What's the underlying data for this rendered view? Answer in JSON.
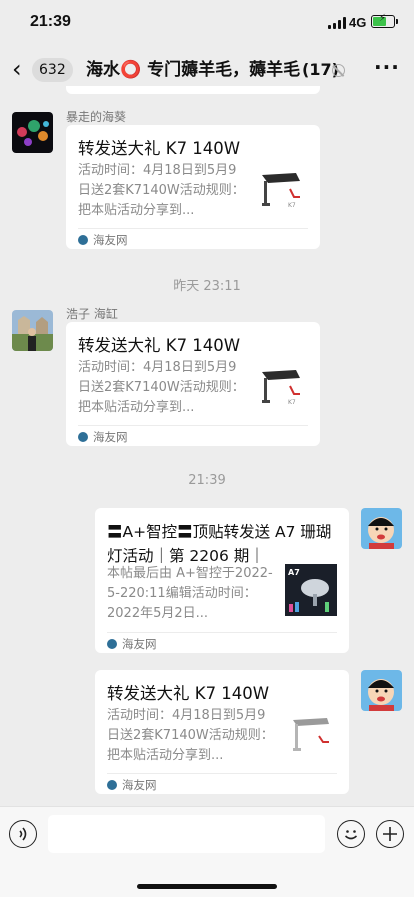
{
  "status_bar": {
    "time": "21:39",
    "network": "4G",
    "battery_level": 0.58
  },
  "header": {
    "back_icon": "chevron-left-icon",
    "unread_count": "632",
    "title": "海水⭕ 专门薅羊毛，薅羊毛群",
    "member_count": "(17)",
    "mute_icon": "bell-slash-icon",
    "more_icon": "more-dots-icon"
  },
  "messages": [
    {
      "sender": "暴走的海葵",
      "card_title": "转发送大礼 K7 140W",
      "card_desc": "活动时间：4月18日到5月9日送2套K7140W活动规则：把本贴活动分享到...",
      "source": "海友网"
    },
    {
      "timestamp": "昨天 23:11"
    },
    {
      "sender": "浩子 海缸",
      "card_title": "转发送大礼 K7 140W",
      "card_desc": "活动时间：4月18日到5月9日送2套K7140W活动规则：把本贴活动分享到...",
      "source": "海友网"
    },
    {
      "timestamp": "21:39"
    },
    {
      "card_title": "〓A+智控〓顶贴转发送 A7 珊瑚灯活动｜第 2206 期｜",
      "card_desc": "本帖最后由 A+智控于2022-5-220:11编辑活动时间：2022年5月2日...",
      "source": "海友网"
    },
    {
      "card_title": "转发送大礼 K7 140W",
      "card_desc": "活动时间：4月18日到5月9日送2套K7140W活动规则：把本贴活动分享到...",
      "source": "海友网"
    }
  ],
  "input_bar": {
    "voice_icon": "voice-icon",
    "emoji_icon": "emoji-icon",
    "plus_icon": "plus-icon"
  },
  "colors": {
    "background": "#ededed",
    "card": "#ffffff",
    "accent_green": "#3cc24a",
    "source_icon": "#2e6f97"
  }
}
